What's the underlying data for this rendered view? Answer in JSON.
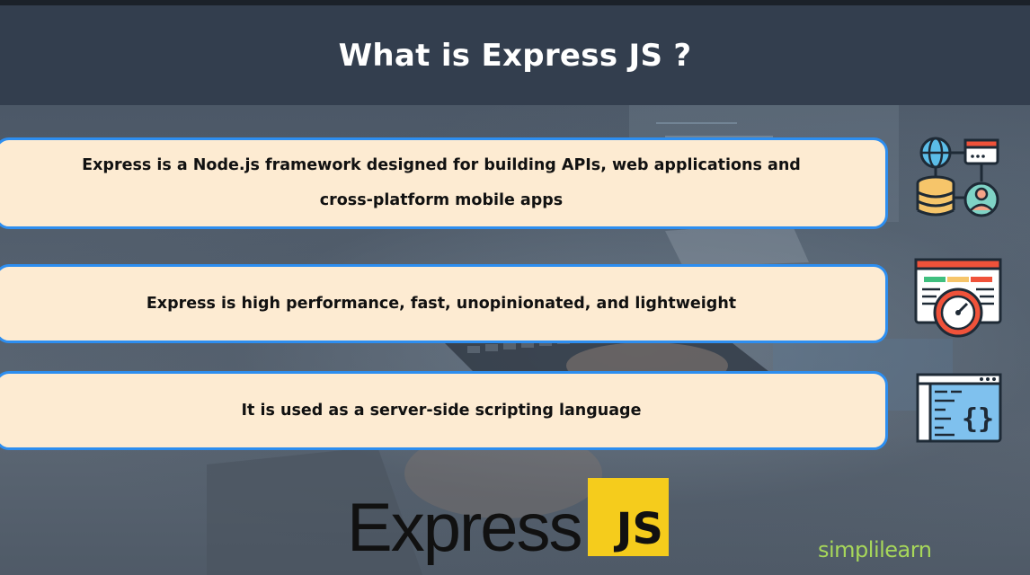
{
  "slide": {
    "title": "What is Express JS ?"
  },
  "points": [
    {
      "lines": [
        "Express is a Node.js framework designed for building APIs, web applications and",
        "cross-platform mobile apps"
      ],
      "icon": "network-database-user-icon"
    },
    {
      "lines": [
        "Express is high performance, fast, unopinionated, and lightweight"
      ],
      "icon": "speedometer-dashboard-icon"
    },
    {
      "lines": [
        "It is used as a server-side scripting language"
      ],
      "icon": "code-window-icon"
    }
  ],
  "logo": {
    "wordmark": "Express",
    "badge": "JS"
  },
  "brand": {
    "name": "simplilearn"
  },
  "colors": {
    "header_bg": "#333e4e",
    "card_bg": "#fdebd2",
    "card_border": "#2d8ef0",
    "js_yellow": "#f5cc1c",
    "brand_green": "#a7d75a"
  }
}
